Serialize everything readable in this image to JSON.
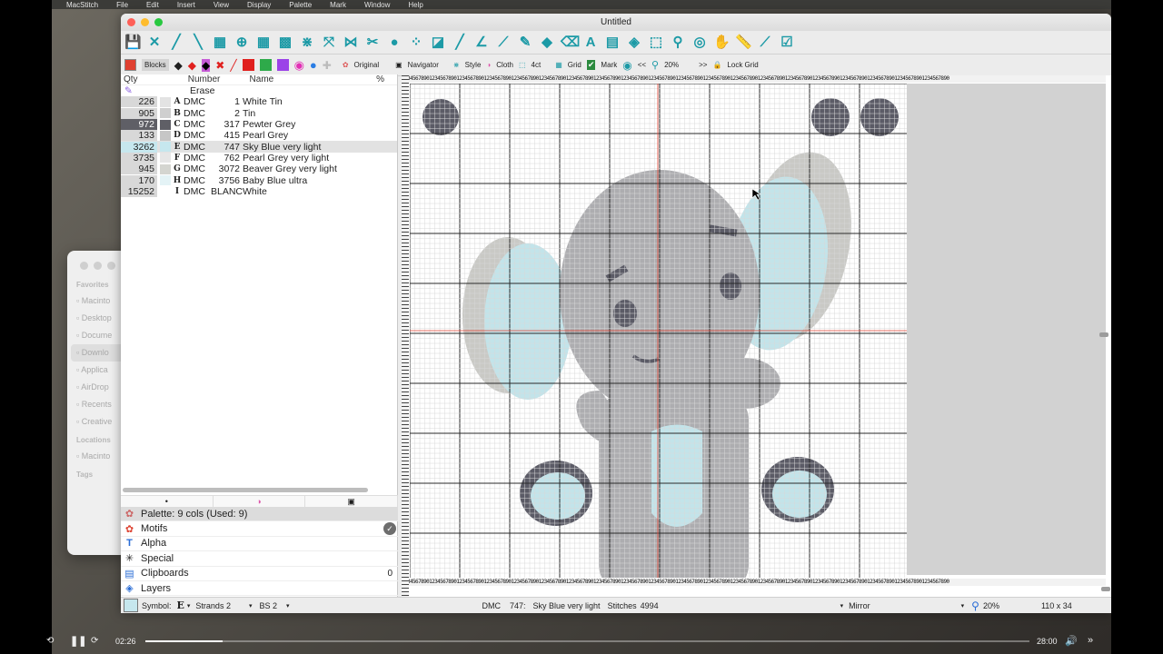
{
  "macmenu": [
    "MacStitch",
    "File",
    "Edit",
    "Insert",
    "View",
    "Display",
    "Palette",
    "Mark",
    "Window",
    "Help"
  ],
  "finder": {
    "sections": [
      {
        "title": "Favorites",
        "items": [
          "Macinto",
          "Desktop",
          "Docume",
          "Downlo",
          "Applica",
          "AirDrop",
          "Recents",
          "Creative"
        ],
        "selected": 3
      },
      {
        "title": "Locations",
        "items": [
          "Macinto"
        ],
        "selected": -1
      },
      {
        "title": "Tags",
        "items": [],
        "selected": -1
      }
    ]
  },
  "window": {
    "title": "Untitled"
  },
  "toolbar2": {
    "blocks_label": "Blocks",
    "original_label": "Original",
    "navigator_label": "Navigator",
    "style_label": "Style",
    "cloth_label": "Cloth",
    "count_label": "4ct",
    "grid_label": "Grid",
    "mark_label": "Mark",
    "prev_label": "<<",
    "zoom_label": "20%",
    "next_label": ">>",
    "lockgrid_label": "Lock Grid"
  },
  "colors": {
    "teal": "#1c9aa6",
    "skyblue": "#c2e4ea",
    "grey_light": "#c9c9c5",
    "grey_mid": "#adadb0",
    "dark": "#5b5b66",
    "red": "#e04030",
    "grid_line": "#d8d8d8",
    "grid_major": "#2a2a2a"
  },
  "palette_table": {
    "headers": {
      "qty": "Qty",
      "number": "Number",
      "name": "Name",
      "pct": "%"
    },
    "erase_label": "Erase",
    "rows": [
      {
        "qty": "226",
        "sym": "A",
        "brand": "DMC",
        "number": "1",
        "name": "White Tin",
        "color": "#e3e3e3",
        "highlight": false
      },
      {
        "qty": "905",
        "sym": "B",
        "brand": "DMC",
        "number": "2",
        "name": "Tin",
        "color": "#cfcfcf",
        "highlight": false
      },
      {
        "qty": "972",
        "sym": "C",
        "brand": "DMC",
        "number": "317",
        "name": "Pewter Grey",
        "color": "#5f5f66",
        "highlight": true
      },
      {
        "qty": "133",
        "sym": "D",
        "brand": "DMC",
        "number": "415",
        "name": "Pearl Grey",
        "color": "#c6c6c6",
        "highlight": false
      },
      {
        "qty": "3262",
        "sym": "E",
        "brand": "DMC",
        "number": "747",
        "name": "Sky Blue very light",
        "color": "#c6e7ee",
        "highlight": false
      },
      {
        "qty": "3735",
        "sym": "F",
        "brand": "DMC",
        "number": "762",
        "name": "Pearl Grey very light",
        "color": "#e6e6e6",
        "highlight": false
      },
      {
        "qty": "945",
        "sym": "G",
        "brand": "DMC",
        "number": "3072",
        "name": "Beaver Grey very light",
        "color": "#d4d5d0",
        "highlight": false
      },
      {
        "qty": "170",
        "sym": "H",
        "brand": "DMC",
        "number": "3756",
        "name": "Baby Blue ultra",
        "color": "#e4f3f6",
        "highlight": false
      },
      {
        "qty": "15252",
        "sym": "I",
        "brand": "DMC",
        "number": "BLANC",
        "name": "White",
        "color": "#ffffff",
        "highlight": false
      }
    ],
    "selected_row": 4
  },
  "library": {
    "palette_header": "Palette: 9 cols (Used: 9)",
    "items": [
      {
        "label": "Motifs",
        "count": ""
      },
      {
        "label": "Alpha",
        "count": ""
      },
      {
        "label": "Special",
        "count": ""
      },
      {
        "label": "Clipboards",
        "count": "0"
      },
      {
        "label": "Layers",
        "count": ""
      }
    ]
  },
  "status": {
    "symbol_label": "Symbol:",
    "symbol_value": "E",
    "strands_label": "Strands 2",
    "bs_label": "BS 2",
    "brand": "DMC",
    "number": "747:",
    "color_name": "Sky Blue very light",
    "stitches_label": "Stitches",
    "stitches_value": "4994",
    "mirror_label": "Mirror",
    "zoom": "20%",
    "dimensions": "110 x 34"
  },
  "player": {
    "current": "02:26",
    "total": "28:00",
    "progress": 0.087
  },
  "ruler_digits": "12345678901234567890123456789012345678901234567890123456789012345678901234567890123456789012345678901234567890123456789012345678901234567890123456789012345678901234567890123456789012345678901234567890"
}
